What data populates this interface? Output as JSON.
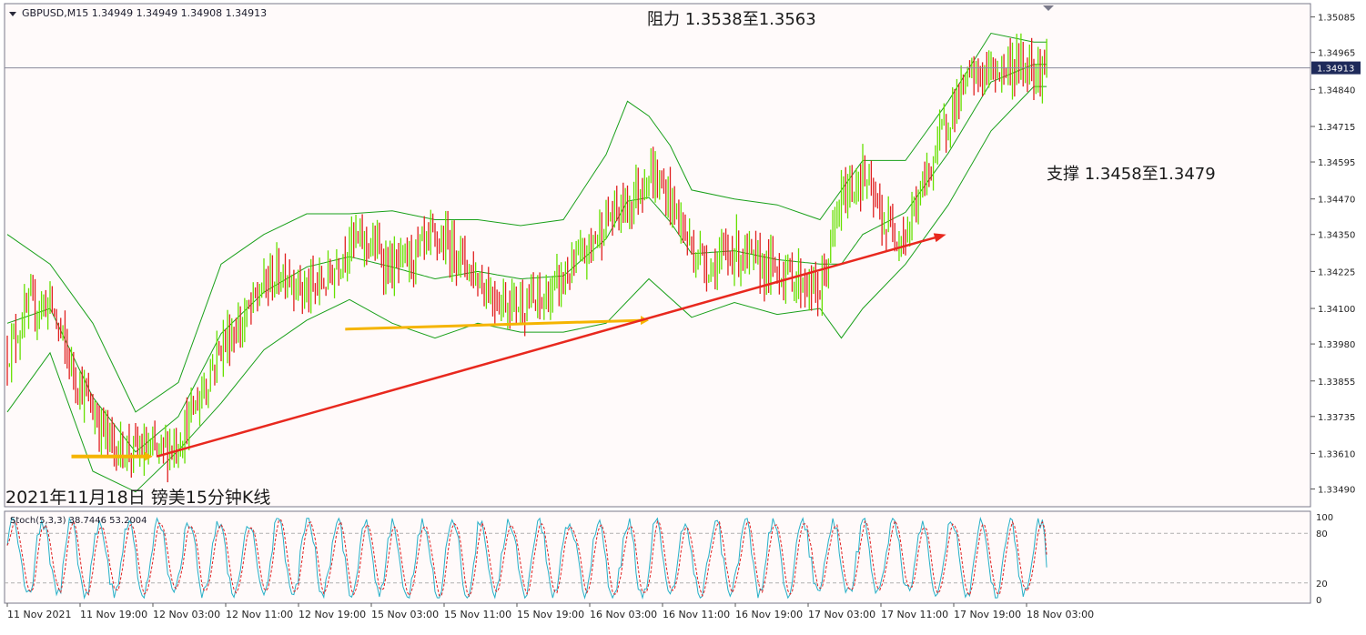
{
  "symbol_header": "GBPUSD,M15  1.34949 1.34949 1.34908 1.34913",
  "stoch_header": "Stoch(5,3,3) 38.7446 53.2004",
  "colors": {
    "background": "#fffafa",
    "bull_candle": "#66e000",
    "bear_candle": "#e02020",
    "bands": "#1aa01a",
    "trend_red": "#e8281e",
    "support_orange": "#f5b400",
    "stoch_main": "#26b0c8",
    "stoch_signal": "#e02020"
  },
  "chart_data": [
    {
      "type": "candlestick",
      "title": "2021年11月18日 镑美15分钟K线",
      "resistance_label": "阻力 1.3538至1.3563",
      "support_label": "支撑 1.3458至1.3479",
      "current_price_label": "1.34913",
      "current_price": 1.34913,
      "ylim": [
        1.3343,
        1.3513
      ],
      "y_ticks": [
        "1.35085",
        "1.34965",
        "1.34840",
        "1.34715",
        "1.34595",
        "1.34470",
        "1.34350",
        "1.34225",
        "1.34100",
        "1.33980",
        "1.33855",
        "1.33735",
        "1.33610",
        "1.33490"
      ],
      "x_ticks": [
        "11 Nov 2021",
        "11 Nov 19:00",
        "12 Nov 03:00",
        "12 Nov 11:00",
        "12 Nov 19:00",
        "15 Nov 03:00",
        "15 Nov 11:00",
        "15 Nov 19:00",
        "16 Nov 03:00",
        "16 Nov 11:00",
        "16 Nov 19:00",
        "17 Nov 03:00",
        "17 Nov 11:00",
        "17 Nov 19:00",
        "18 Nov 03:00"
      ],
      "price_path": [
        [
          0,
          1.3395
        ],
        [
          10,
          1.341
        ],
        [
          20,
          1.3412
        ],
        [
          30,
          1.339
        ],
        [
          40,
          1.3375
        ],
        [
          50,
          1.3363
        ],
        [
          60,
          1.3362
        ],
        [
          70,
          1.3361
        ],
        [
          80,
          1.3365
        ],
        [
          90,
          1.338
        ],
        [
          100,
          1.3398
        ],
        [
          110,
          1.3405
        ],
        [
          120,
          1.3418
        ],
        [
          130,
          1.3423
        ],
        [
          140,
          1.3415
        ],
        [
          150,
          1.342
        ],
        [
          160,
          1.3433
        ],
        [
          170,
          1.3432
        ],
        [
          180,
          1.3423
        ],
        [
          190,
          1.3428
        ],
        [
          200,
          1.3433
        ],
        [
          210,
          1.343
        ],
        [
          220,
          1.342
        ],
        [
          230,
          1.3413
        ],
        [
          240,
          1.3412
        ],
        [
          250,
          1.3412
        ],
        [
          260,
          1.342
        ],
        [
          270,
          1.3428
        ],
        [
          280,
          1.344
        ],
        [
          290,
          1.3445
        ],
        [
          300,
          1.3456
        ],
        [
          310,
          1.3447
        ],
        [
          320,
          1.343
        ],
        [
          330,
          1.3424
        ],
        [
          340,
          1.343
        ],
        [
          350,
          1.3425
        ],
        [
          360,
          1.3423
        ],
        [
          370,
          1.342
        ],
        [
          380,
          1.3415
        ],
        [
          390,
          1.3447
        ],
        [
          400,
          1.3455
        ],
        [
          410,
          1.3438
        ],
        [
          420,
          1.3435
        ],
        [
          430,
          1.3455
        ],
        [
          440,
          1.3475
        ],
        [
          450,
          1.3488
        ],
        [
          460,
          1.349
        ],
        [
          470,
          1.3492
        ],
        [
          480,
          1.3492
        ],
        [
          486,
          1.34913
        ]
      ],
      "upper_band": [
        [
          0,
          1.3435
        ],
        [
          20,
          1.3425
        ],
        [
          40,
          1.3405
        ],
        [
          60,
          1.3375
        ],
        [
          80,
          1.3385
        ],
        [
          100,
          1.3425
        ],
        [
          120,
          1.3435
        ],
        [
          140,
          1.3442
        ],
        [
          160,
          1.3442
        ],
        [
          180,
          1.3443
        ],
        [
          200,
          1.344
        ],
        [
          220,
          1.344
        ],
        [
          240,
          1.3438
        ],
        [
          260,
          1.344
        ],
        [
          280,
          1.3462
        ],
        [
          290,
          1.348
        ],
        [
          300,
          1.3475
        ],
        [
          310,
          1.3465
        ],
        [
          320,
          1.345
        ],
        [
          340,
          1.3447
        ],
        [
          360,
          1.3445
        ],
        [
          380,
          1.344
        ],
        [
          400,
          1.346
        ],
        [
          420,
          1.346
        ],
        [
          440,
          1.348
        ],
        [
          460,
          1.3503
        ],
        [
          480,
          1.35
        ],
        [
          486,
          1.35
        ]
      ],
      "lower_band": [
        [
          0,
          1.3375
        ],
        [
          20,
          1.3395
        ],
        [
          40,
          1.3355
        ],
        [
          60,
          1.3348
        ],
        [
          80,
          1.3362
        ],
        [
          100,
          1.3378
        ],
        [
          120,
          1.3396
        ],
        [
          140,
          1.3406
        ],
        [
          160,
          1.3413
        ],
        [
          180,
          1.3405
        ],
        [
          200,
          1.34
        ],
        [
          220,
          1.3405
        ],
        [
          240,
          1.3402
        ],
        [
          260,
          1.3402
        ],
        [
          280,
          1.3405
        ],
        [
          300,
          1.342
        ],
        [
          320,
          1.3407
        ],
        [
          340,
          1.3412
        ],
        [
          360,
          1.3408
        ],
        [
          380,
          1.341
        ],
        [
          390,
          1.34
        ],
        [
          400,
          1.341
        ],
        [
          420,
          1.3425
        ],
        [
          440,
          1.3445
        ],
        [
          460,
          1.347
        ],
        [
          480,
          1.3485
        ],
        [
          486,
          1.3485
        ]
      ],
      "red_trendline": [
        [
          70,
          1.336
        ],
        [
          439,
          1.3435
        ]
      ],
      "support_arrows": [
        [
          [
            30,
            1.336
          ],
          [
            68,
            1.336
          ]
        ],
        [
          [
            158,
            1.3403
          ],
          [
            300,
            1.3406
          ]
        ]
      ]
    },
    {
      "type": "line",
      "name": "Stoch(5,3,3)",
      "main_value": 38.7446,
      "signal_value": 53.2004,
      "ylim": [
        0,
        100
      ],
      "y_ticks": [
        "100",
        "80",
        "20",
        "0"
      ],
      "levels": [
        20,
        80
      ]
    }
  ]
}
